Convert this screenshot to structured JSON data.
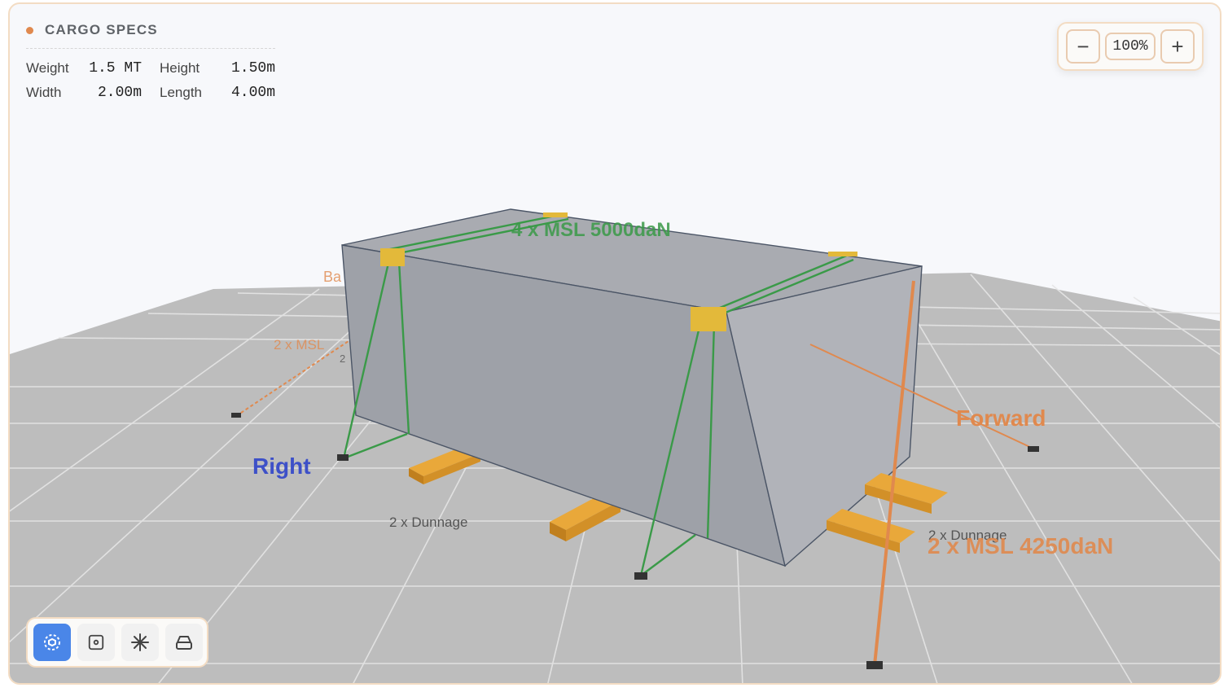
{
  "specs": {
    "title": "CARGO SPECS",
    "weight_label": "Weight",
    "weight_value": "1.5 MT",
    "height_label": "Height",
    "height_value": "1.50m",
    "width_label": "Width",
    "width_value": "2.00m",
    "length_label": "Length",
    "length_value": "4.00m"
  },
  "zoom": {
    "minus": "−",
    "percent": "100%",
    "plus": "+"
  },
  "scene": {
    "lashing_top": "4 x MSL 5000daN",
    "lashing_back": "2 x MSL",
    "back_label": "Ba",
    "right_label": "Right",
    "forward_label": "Forward",
    "dunnage_left": "2 x Dunnage",
    "dunnage_right": "2 x Dunnage",
    "lashing_front": "2 x MSL 4250daN",
    "small_two": "2"
  },
  "toolbar": {
    "tools": [
      "orbit-icon",
      "focus-icon",
      "sparkle-icon",
      "box-view-icon"
    ]
  },
  "colors": {
    "accent": "#e0894e",
    "active_tool": "#4a86e8",
    "lashing_green": "#3a9a48",
    "lashing_orange": "#e0894e",
    "dunnage": "#d9982c",
    "cargo": "#a4a7ae",
    "floor": "#bdbdbd",
    "label_right": "#3d50c8"
  }
}
